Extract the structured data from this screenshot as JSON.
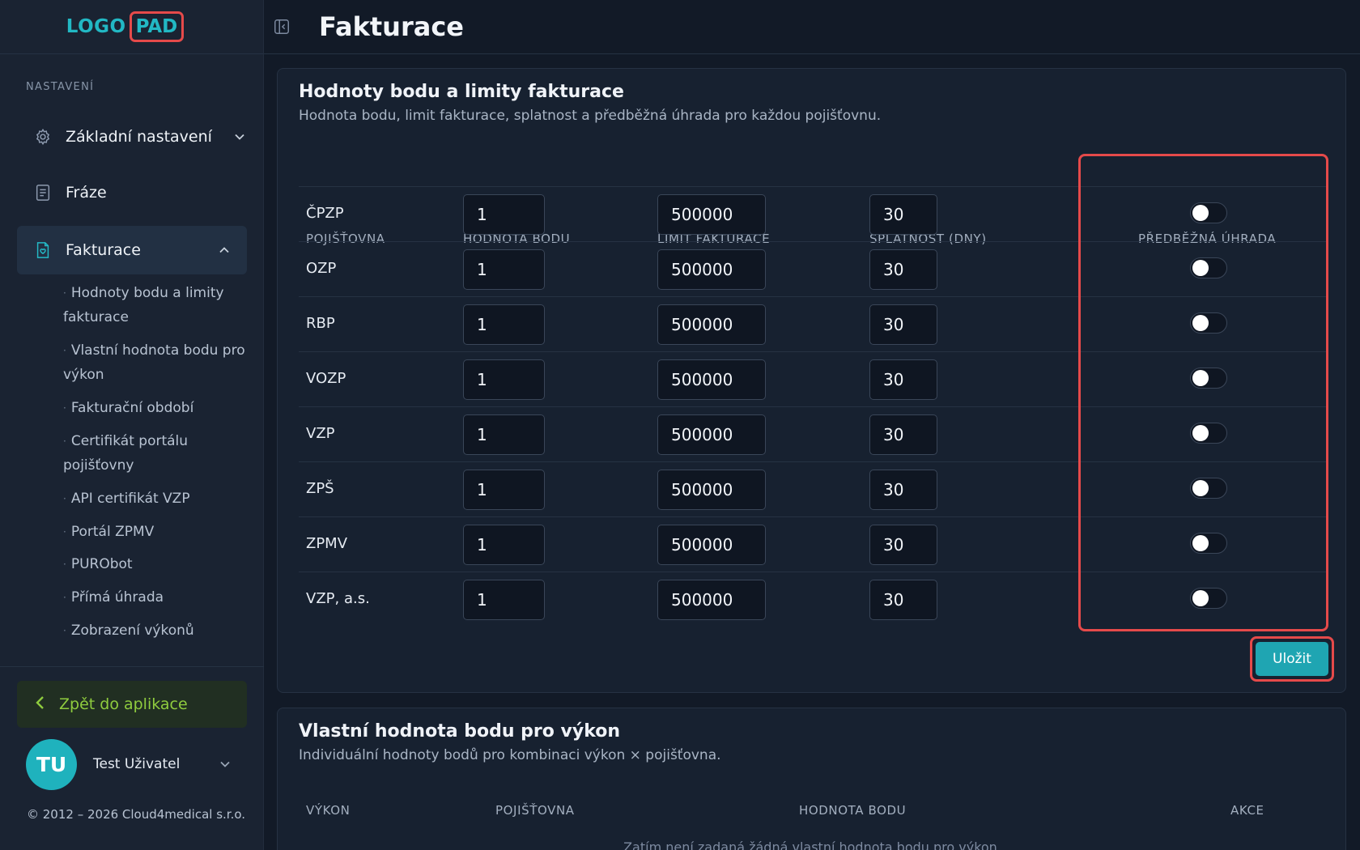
{
  "logo": {
    "part1": "LOGO",
    "part2": "PAD"
  },
  "sidebar": {
    "section_label": "NASTAVENÍ",
    "items": [
      {
        "label": "Základní nastavení",
        "icon": "gear-icon"
      },
      {
        "label": "Fráze",
        "icon": "document-icon"
      },
      {
        "label": "Fakturace",
        "icon": "invoice-icon"
      }
    ],
    "sub_items": [
      {
        "line1": "Hodnoty bodu a limity",
        "line2": "fakturace"
      },
      {
        "line1": "Vlastní hodnota bodu pro",
        "line2": "výkon"
      },
      {
        "line1": "Fakturační období",
        "line2": ""
      },
      {
        "line1": "Certifikát portálu",
        "line2": "pojišťovny"
      },
      {
        "line1": "API certifikát VZP",
        "line2": ""
      },
      {
        "line1": "Portál ZPMV",
        "line2": ""
      },
      {
        "line1": "PURObot",
        "line2": ""
      },
      {
        "line1": "Přímá úhrada",
        "line2": ""
      },
      {
        "line1": "Zobrazení výkonů",
        "line2": ""
      }
    ],
    "back_label": "Zpět do aplikace",
    "user": {
      "initials": "TU",
      "name": "Test Uživatel"
    },
    "copyright": "© 2012 – 2026 Cloud4medical s.r.o."
  },
  "header": {
    "title": "Fakturace"
  },
  "card1": {
    "title": "Hodnoty bodu a limity fakturace",
    "subtitle": "Hodnota bodu, limit fakturace, splatnost a předběžná úhrada pro každou pojišťovnu.",
    "columns": [
      "POJIŠŤOVNA",
      "HODNOTA BODU",
      "LIMIT FAKTURACE",
      "SPLATNOST (DNY)",
      "PŘEDBĚŽNÁ ÚHRADA"
    ],
    "rows": [
      {
        "name": "ČPZP",
        "point_value": "1",
        "limit": "500000",
        "due_days": "30",
        "prepay": false
      },
      {
        "name": "OZP",
        "point_value": "1",
        "limit": "500000",
        "due_days": "30",
        "prepay": false
      },
      {
        "name": "RBP",
        "point_value": "1",
        "limit": "500000",
        "due_days": "30",
        "prepay": false
      },
      {
        "name": "VOZP",
        "point_value": "1",
        "limit": "500000",
        "due_days": "30",
        "prepay": false
      },
      {
        "name": "VZP",
        "point_value": "1",
        "limit": "500000",
        "due_days": "30",
        "prepay": false
      },
      {
        "name": "ZPŠ",
        "point_value": "1",
        "limit": "500000",
        "due_days": "30",
        "prepay": false
      },
      {
        "name": "ZPMV",
        "point_value": "1",
        "limit": "500000",
        "due_days": "30",
        "prepay": false
      },
      {
        "name": "VZP, a.s.",
        "point_value": "1",
        "limit": "500000",
        "due_days": "30",
        "prepay": false
      }
    ],
    "save_label": "Uložit"
  },
  "card2": {
    "title": "Vlastní hodnota bodu pro výkon",
    "subtitle": "Individuální hodnoty bodů pro kombinaci výkon × pojišťovna.",
    "columns": [
      "VÝKON",
      "POJIŠŤOVNA",
      "HODNOTA BODU",
      "AKCE"
    ],
    "empty_message": "Zatím není zadaná žádná vlastní hodnota bodu pro výkon."
  },
  "colors": {
    "accent": "#1fa5b2",
    "highlight": "#e54a4a",
    "back_link": "#8fcc3e",
    "background": "#121a27"
  }
}
